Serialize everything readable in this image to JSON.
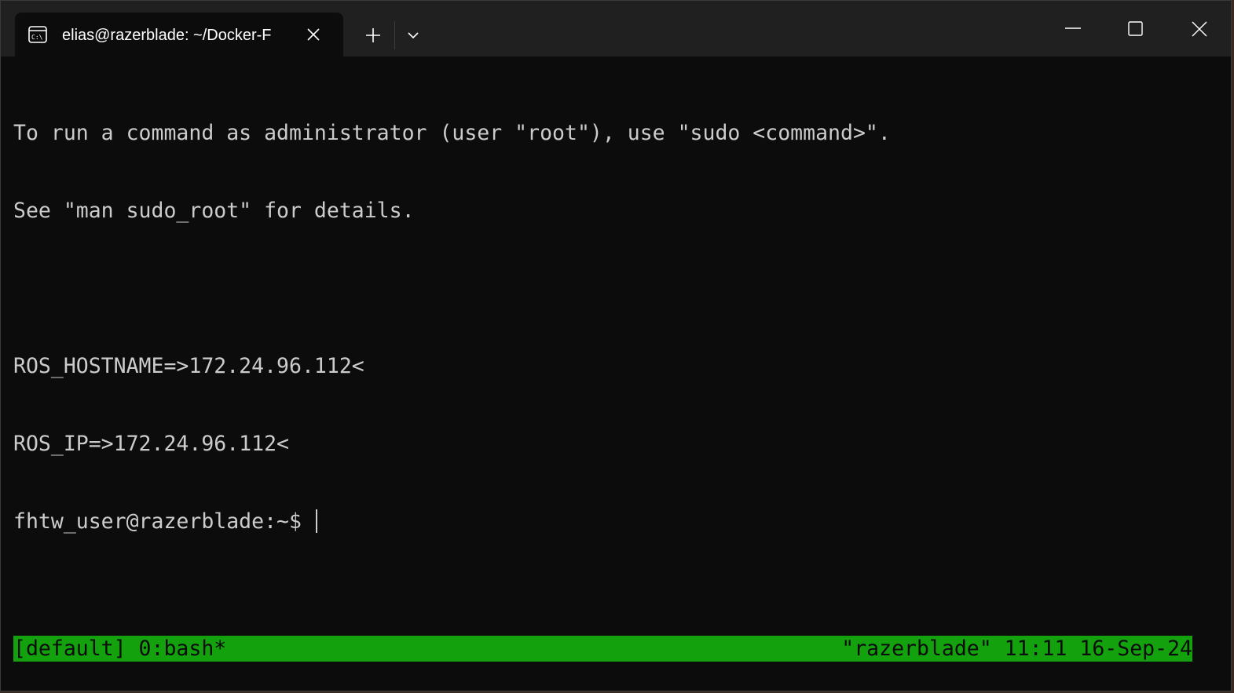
{
  "window": {
    "tab_title": "elias@razerblade: ~/Docker-F",
    "tab_icon": "terminal-icon",
    "new_tab_icon": "plus-icon",
    "dropdown_icon": "chevron-down-icon",
    "controls": [
      "minimize-icon",
      "maximize-icon",
      "close-icon"
    ]
  },
  "terminal": {
    "lines": [
      "To run a command as administrator (user \"root\"), use \"sudo <command>\".",
      "See \"man sudo_root\" for details.",
      "",
      "ROS_HOSTNAME=>172.24.96.112<",
      "ROS_IP=>172.24.96.112<"
    ],
    "prompt": "fhtw_user@razerblade:~$ "
  },
  "statusbar": {
    "left": "[default] 0:bash*",
    "right": "\"razerblade\" 11:11 16-Sep-24",
    "color": "#13a10e"
  },
  "colors": {
    "background": "#0c0c0c",
    "titlebar": "#202020",
    "text": "#cccccc"
  }
}
